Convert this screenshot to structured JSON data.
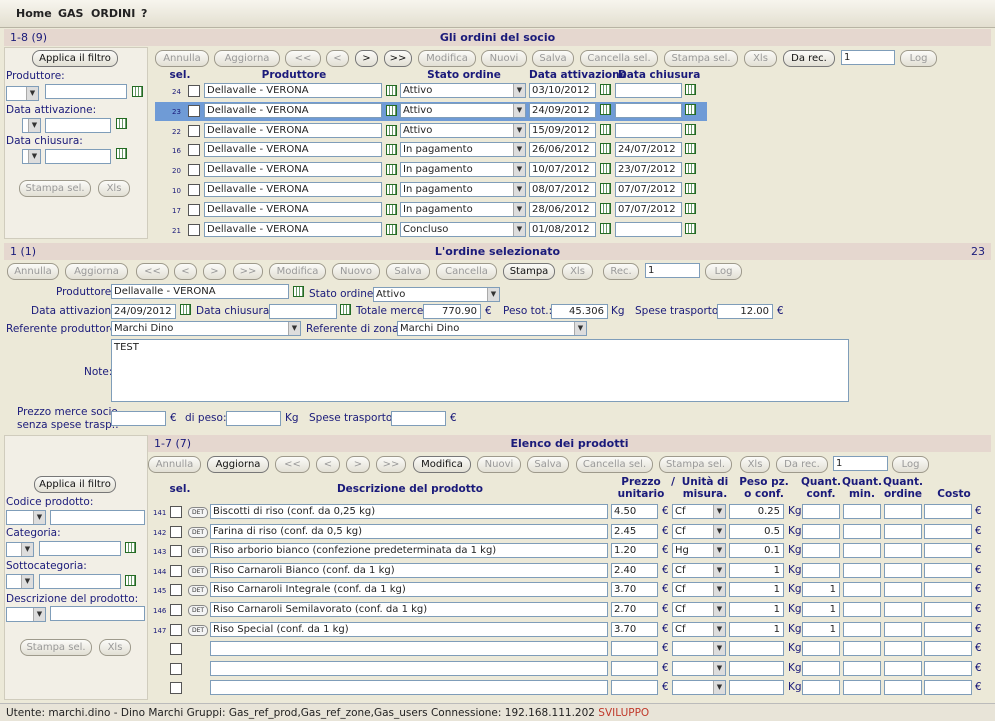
{
  "menu": [
    "Home",
    "GAS",
    "ORDINI",
    "?"
  ],
  "orders": {
    "title": "Gli ordini del socio",
    "count": "1-8 (9)",
    "apply_filter": "Applica il filtro",
    "filter_labels": {
      "producer": "Produttore:",
      "activation": "Data attivazione:",
      "closing": "Data chiusura:"
    },
    "print_sel": "Stampa sel.",
    "xls": "Xls",
    "toolbar": [
      "Annulla",
      "Aggiorna",
      "<<",
      "<",
      ">",
      ">>",
      "Modifica",
      "Nuovi",
      "Salva",
      "Cancella sel.",
      "Stampa sel.",
      "Xls",
      "Da rec."
    ],
    "toolbar_enabled": [
      false,
      false,
      false,
      false,
      true,
      true,
      false,
      false,
      false,
      false,
      false,
      false,
      true
    ],
    "rec_value": "1",
    "log": "Log",
    "headers": {
      "sel": "sel.",
      "producer": "Produttore",
      "status": "Stato ordine",
      "activation": "Data attivazione",
      "closing": "Data chiusura"
    },
    "rows": [
      {
        "id": "24",
        "producer": "Dellavalle - VERONA",
        "status": "Attivo",
        "activation": "03/10/2012",
        "closing": ""
      },
      {
        "id": "23",
        "producer": "Dellavalle - VERONA",
        "status": "Attivo",
        "activation": "24/09/2012",
        "closing": ""
      },
      {
        "id": "22",
        "producer": "Dellavalle - VERONA",
        "status": "Attivo",
        "activation": "15/09/2012",
        "closing": ""
      },
      {
        "id": "16",
        "producer": "Dellavalle - VERONA",
        "status": "In pagamento",
        "activation": "26/06/2012",
        "closing": "24/07/2012"
      },
      {
        "id": "20",
        "producer": "Dellavalle - VERONA",
        "status": "In pagamento",
        "activation": "10/07/2012",
        "closing": "23/07/2012"
      },
      {
        "id": "10",
        "producer": "Dellavalle - VERONA",
        "status": "In pagamento",
        "activation": "08/07/2012",
        "closing": "07/07/2012"
      },
      {
        "id": "17",
        "producer": "Dellavalle - VERONA",
        "status": "In pagamento",
        "activation": "28/06/2012",
        "closing": "07/07/2012"
      },
      {
        "id": "21",
        "producer": "Dellavalle - VERONA",
        "status": "Concluso",
        "activation": "01/08/2012",
        "closing": ""
      }
    ]
  },
  "selected": {
    "count": "1 (1)",
    "title": "L'ordine selezionato",
    "id": "23",
    "toolbar": [
      "Annulla",
      "Aggiorna",
      "<<",
      "<",
      ">",
      ">>",
      "Modifica",
      "Nuovo",
      "Salva",
      "Cancella",
      "Stampa",
      "Xls",
      "Rec."
    ],
    "toolbar_enabled": [
      false,
      false,
      false,
      false,
      false,
      false,
      false,
      false,
      false,
      false,
      true,
      false,
      false
    ],
    "rec_value": "1",
    "log": "Log",
    "labels": {
      "producer": "Produttore:",
      "status": "Stato ordine:",
      "activation": "Data attivazione:",
      "closing": "Data chiusura:",
      "total": "Totale merce:",
      "weight": "Peso tot.:",
      "shipping": "Spese trasporto:",
      "ref_prod": "Referente produttore:",
      "ref_zone": "Referente di zona:",
      "notes": "Note:",
      "price_member": "Prezzo merce socio",
      "no_shipping": "senza spese trasp.:",
      "of_weight": "di peso:",
      "shipping2": "Spese trasporto:"
    },
    "producer": "Dellavalle - VERONA",
    "status": "Attivo",
    "activation": "24/09/2012",
    "closing": "",
    "total": "770.90",
    "weight": "45.306",
    "weight_unit": "Kg",
    "shipping": "12.00",
    "currency": "€",
    "ref_prod": "Marchi Dino",
    "ref_zone": "Marchi Dino",
    "notes": "TEST"
  },
  "products": {
    "count": "1-7 (7)",
    "title": "Elenco dei prodotti",
    "apply_filter": "Applica il filtro",
    "filter_labels": {
      "code": "Codice prodotto:",
      "category": "Categoria:",
      "subcategory": "Sottocategoria:",
      "description": "Descrizione del prodotto:"
    },
    "print_sel": "Stampa sel.",
    "xls": "Xls",
    "toolbar": [
      "Annulla",
      "Aggiorna",
      "<<",
      "<",
      ">",
      ">>",
      "Modifica",
      "Nuovi",
      "Salva",
      "Cancella sel.",
      "Stampa sel.",
      "Xls",
      "Da rec."
    ],
    "toolbar_enabled": [
      false,
      true,
      false,
      false,
      false,
      false,
      true,
      false,
      false,
      false,
      false,
      false,
      false
    ],
    "rec_value": "1",
    "log": "Log",
    "headers": {
      "sel": "sel.",
      "desc": "Descrizione del prodotto",
      "price1": "Prezzo",
      "price2": "unitario",
      "slash": "/",
      "unit1": "Unità di",
      "unit2": "misura.",
      "weight1": "Peso pz.",
      "weight2": "o conf.",
      "qc1": "Quant.",
      "qc2": "conf.",
      "qm1": "Quant.",
      "qm2": "min.",
      "qo1": "Quant.",
      "qo2": "ordine",
      "cost": "Costo"
    },
    "det": "DET",
    "rows": [
      {
        "id": "141",
        "desc": "Biscotti di riso (conf. da 0,25 kg)",
        "price": "4.50",
        "unit": "Cf",
        "weight": "0.25",
        "qconf": ""
      },
      {
        "id": "142",
        "desc": "Farina di riso (conf. da 0,5 kg)",
        "price": "2.45",
        "unit": "Cf",
        "weight": "0.5",
        "qconf": ""
      },
      {
        "id": "143",
        "desc": "Riso arborio bianco (confezione predeterminata da 1 kg)",
        "price": "1.20",
        "unit": "Hg",
        "weight": "0.1",
        "qconf": ""
      },
      {
        "id": "144",
        "desc": "Riso Carnaroli Bianco (conf. da 1 kg)",
        "price": "2.40",
        "unit": "Cf",
        "weight": "1",
        "qconf": ""
      },
      {
        "id": "145",
        "desc": "Riso Carnaroli Integrale (conf. da 1 kg)",
        "price": "3.70",
        "unit": "Cf",
        "weight": "1",
        "qconf": "1"
      },
      {
        "id": "146",
        "desc": "Riso Carnaroli Semilavorato (conf. da 1 kg)",
        "price": "2.70",
        "unit": "Cf",
        "weight": "1",
        "qconf": "1"
      },
      {
        "id": "147",
        "desc": "Riso Special (conf. da 1 kg)",
        "price": "3.70",
        "unit": "Cf",
        "weight": "1",
        "qconf": "1"
      }
    ],
    "kg": "Kg",
    "eur": "€"
  },
  "status": {
    "text": "Utente: marchi.dino - Dino Marchi Gruppi: Gas_ref_prod,Gas_ref_zone,Gas_users Connessione: 192.168.111.202",
    "env": "SVILUPPO",
    "env_color": "#c0392b"
  }
}
